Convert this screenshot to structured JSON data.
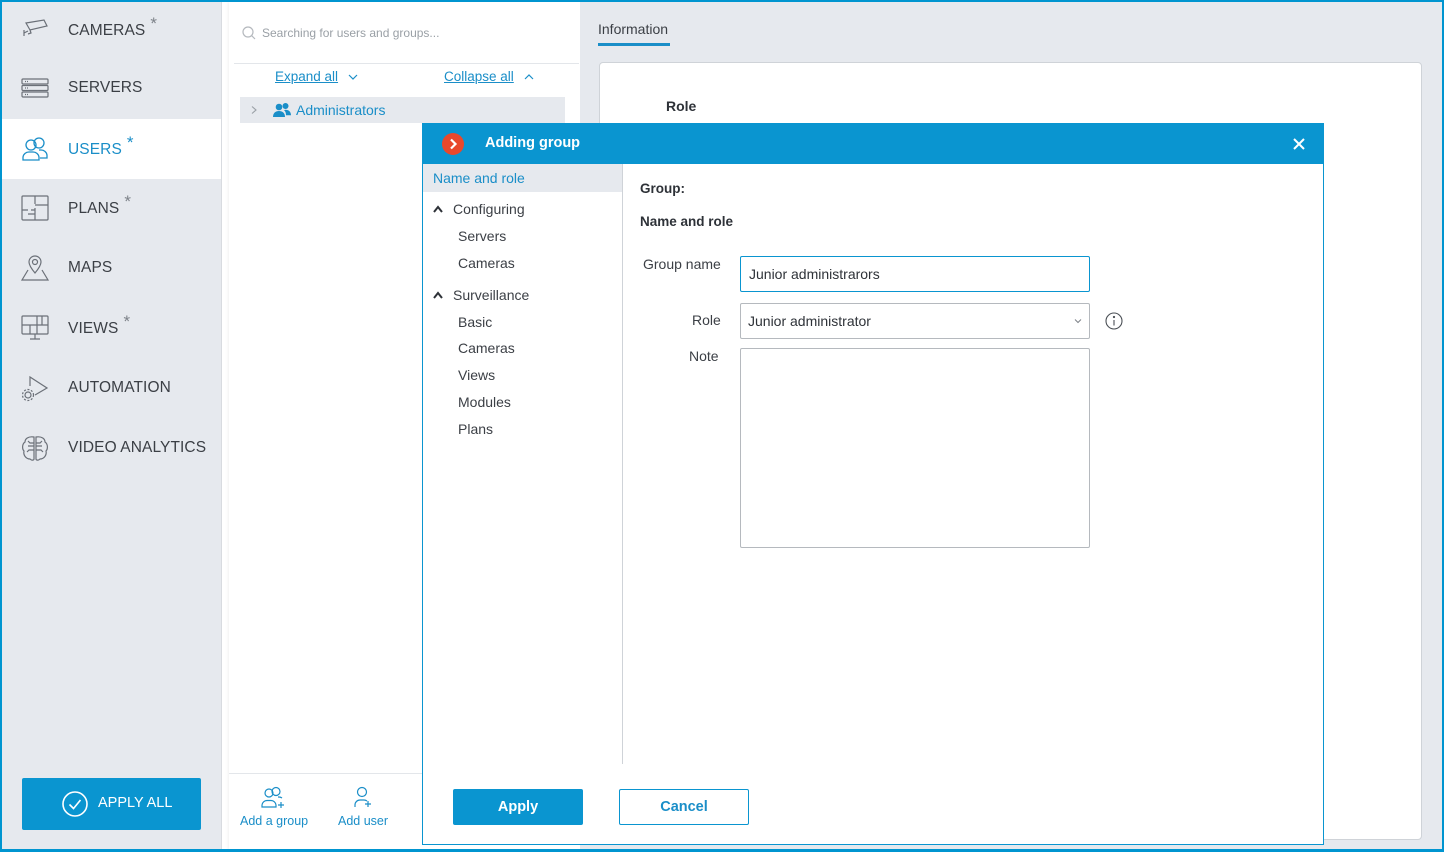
{
  "sidebar": {
    "items": [
      {
        "label": "CAMERAS",
        "icon": "camera-icon",
        "modified": true,
        "active": false
      },
      {
        "label": "SERVERS",
        "icon": "server-icon",
        "modified": false,
        "active": false
      },
      {
        "label": "USERS",
        "icon": "users-icon",
        "modified": true,
        "active": true
      },
      {
        "label": "PLANS",
        "icon": "floor-plan-icon",
        "modified": true,
        "active": false
      },
      {
        "label": "MAPS",
        "icon": "map-pin-icon",
        "modified": false,
        "active": false
      },
      {
        "label": "VIEWS",
        "icon": "monitor-layout-icon",
        "modified": true,
        "active": false
      },
      {
        "label": "AUTOMATION",
        "icon": "automation-gear-icon",
        "modified": false,
        "active": false
      },
      {
        "label": "VIDEO ANALYTICS",
        "icon": "brain-icon",
        "modified": false,
        "active": false
      }
    ],
    "modified_marker": "*",
    "apply_all_label": "APPLY ALL"
  },
  "tree": {
    "search_placeholder": "Searching for users and groups...",
    "expand_all": "Expand all",
    "collapse_all": "Collapse all",
    "groups": [
      {
        "name": "Administrators",
        "expanded": false
      }
    ],
    "add_group_label": "Add a group",
    "add_user_label": "Add user"
  },
  "details": {
    "tab_label": "Information",
    "role_heading": "Role"
  },
  "modal": {
    "title": "Adding group",
    "nav": {
      "active": "Name and role",
      "groups": [
        {
          "label": "Configuring",
          "expanded": true,
          "items": [
            "Servers",
            "Cameras"
          ]
        },
        {
          "label": "Surveillance",
          "expanded": true,
          "items": [
            "Basic",
            "Cameras",
            "Views",
            "Modules",
            "Plans"
          ]
        }
      ]
    },
    "group_heading": "Group:",
    "section_heading": "Name and role",
    "fields": {
      "group_name_label": "Group name",
      "group_name_value": "Junior administrarors",
      "role_label": "Role",
      "role_value": "Junior administrator",
      "note_label": "Note",
      "note_value": ""
    },
    "apply_label": "Apply",
    "cancel_label": "Cancel"
  },
  "colors": {
    "accent": "#0a95d0",
    "logo": "#e8482c",
    "sidebar_bg": "#e6e9ee"
  }
}
